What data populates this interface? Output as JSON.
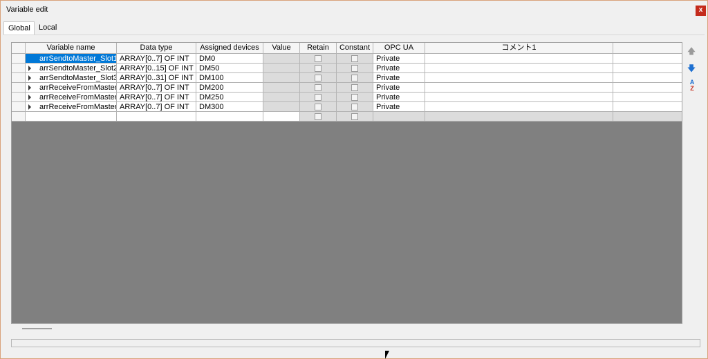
{
  "window": {
    "title": "Variable edit",
    "close_label": "x"
  },
  "tabs": [
    {
      "label": "Global"
    },
    {
      "label": "Local"
    }
  ],
  "columns": {
    "name": "Variable name",
    "type": "Data type",
    "devices": "Assigned devices",
    "value": "Value",
    "retain": "Retain",
    "constant": "Constant",
    "opc": "OPC UA",
    "comment": "コメント1"
  },
  "rows": [
    {
      "name": "arrSendtoMaster_Slot1",
      "type": "ARRAY[0..7] OF INT",
      "devices": "DM0",
      "opc": "Private",
      "selected": true
    },
    {
      "name": "arrSendtoMaster_Slot2",
      "type": "ARRAY[0..15] OF INT",
      "devices": "DM50",
      "opc": "Private"
    },
    {
      "name": "arrSendtoMaster_Slot3",
      "type": "ARRAY[0..31] OF INT",
      "devices": "DM100",
      "opc": "Private"
    },
    {
      "name": "arrReceiveFromMaster_",
      "type": "ARRAY[0..7] OF INT",
      "devices": "DM200",
      "opc": "Private"
    },
    {
      "name": "arrReceiveFromMaster_",
      "type": "ARRAY[0..7] OF INT",
      "devices": "DM250",
      "opc": "Private"
    },
    {
      "name": "arrReceiveFromMaster_",
      "type": "ARRAY[0..7] OF INT",
      "devices": "DM300",
      "opc": "Private"
    }
  ],
  "side_buttons": [
    {
      "name": "move-up",
      "icon": "arrow-up-icon"
    },
    {
      "name": "move-down",
      "icon": "arrow-down-icon"
    },
    {
      "name": "sort",
      "icon": "sort-az-icon"
    }
  ],
  "colors": {
    "selection": "#0078d7",
    "grid_background": "#808080",
    "close": "#c42b1c"
  }
}
